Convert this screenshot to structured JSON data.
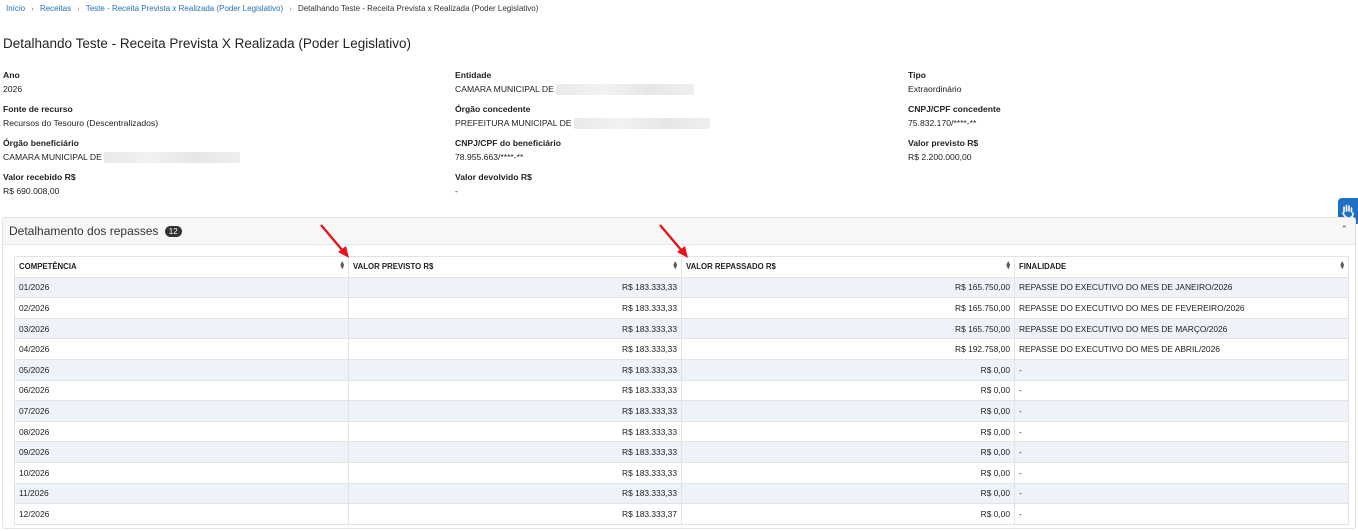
{
  "breadcrumb": {
    "items": [
      "Início",
      "Receitas",
      "Teste - Receita Prevista x Realizada (Poder Legislativo)"
    ],
    "current": "Detalhando Teste - Receita Prevista x Realizada (Poder Legislativo)"
  },
  "page": {
    "title": "Detalhando Teste - Receita Prevista X Realizada (Poder Legislativo)"
  },
  "details": {
    "ano": {
      "label": "Ano",
      "value": "2026"
    },
    "entidade": {
      "label": "Entidade",
      "value": "CAMARA MUNICIPAL DE"
    },
    "tipo": {
      "label": "Tipo",
      "value": "Extraordinário"
    },
    "fonte": {
      "label": "Fonte de recurso",
      "value": "Recursos do Tesouro (Descentralizados)"
    },
    "orgao_concedente": {
      "label": "Órgão concedente",
      "value": "PREFEITURA MUNICIPAL DE"
    },
    "cnpj_concedente": {
      "label": "CNPJ/CPF concedente",
      "value": "75.832.170/****-**"
    },
    "orgao_beneficiario": {
      "label": "Órgão beneficiário",
      "value": "CAMARA MUNICIPAL DE"
    },
    "cnpj_beneficiario": {
      "label": "CNPJ/CPF do beneficiário",
      "value": "78.955.663/****-**"
    },
    "valor_previsto": {
      "label": "Valor previsto R$",
      "value": "R$ 2.200.000,00"
    },
    "valor_recebido": {
      "label": "Valor recebido R$",
      "value": "R$ 690.008,00"
    },
    "valor_devolvido": {
      "label": "Valor devolvido R$",
      "value": "-"
    }
  },
  "panel": {
    "title": "Detalhamento dos repasses",
    "count": "12"
  },
  "table": {
    "headers": [
      "COMPETÊNCIA",
      "VALOR PREVISTO R$",
      "VALOR REPASSADO R$",
      "FINALIDADE"
    ],
    "rows": [
      [
        "01/2026",
        "R$ 183.333,33",
        "R$ 165.750,00",
        "REPASSE DO EXECUTIVO DO MES DE JANEIRO/2026"
      ],
      [
        "02/2026",
        "R$ 183.333,33",
        "R$ 165.750,00",
        "REPASSE DO EXECUTIVO DO MES DE FEVEREIRO/2026"
      ],
      [
        "03/2026",
        "R$ 183.333,33",
        "R$ 165.750,00",
        "REPASSE DO EXECUTIVO DO MES DE MARÇO/2026"
      ],
      [
        "04/2026",
        "R$ 183.333,33",
        "R$ 192.758,00",
        "REPASSE DO EXECUTIVO DO MES DE ABRIL/2026"
      ],
      [
        "05/2026",
        "R$ 183.333,33",
        "R$ 0,00",
        "-"
      ],
      [
        "06/2026",
        "R$ 183.333,33",
        "R$ 0,00",
        "-"
      ],
      [
        "07/2026",
        "R$ 183.333,33",
        "R$ 0,00",
        "-"
      ],
      [
        "08/2026",
        "R$ 183.333,33",
        "R$ 0,00",
        "-"
      ],
      [
        "09/2026",
        "R$ 183.333,33",
        "R$ 0,00",
        "-"
      ],
      [
        "10/2026",
        "R$ 183.333,33",
        "R$ 0,00",
        "-"
      ],
      [
        "11/2026",
        "R$ 183.333,33",
        "R$ 0,00",
        "-"
      ],
      [
        "12/2026",
        "R$ 183.333,37",
        "R$ 0,00",
        "-"
      ]
    ]
  },
  "colors": {
    "link": "#2a6fb5",
    "row_stripe": "#eef3fa",
    "annotation_arrow": "#e3161b",
    "accessibility_button": "#1f6fc5"
  },
  "icons": {
    "sort": "sort-icon",
    "collapse": "chevron-up-icon",
    "accessibility": "accessibility-hand-icon",
    "annotation": "red-arrow-annotation"
  }
}
